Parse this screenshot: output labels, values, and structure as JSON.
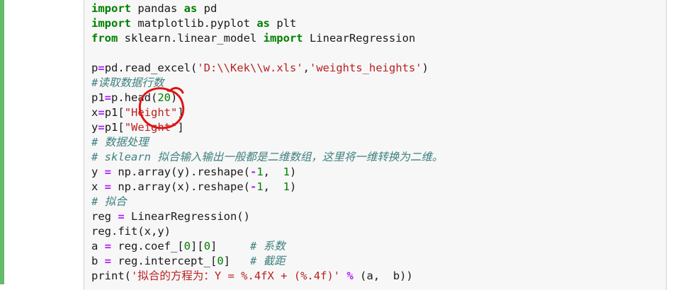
{
  "code_cell": {
    "lines": [
      [
        [
          "kw",
          "import"
        ],
        [
          "t",
          " pandas "
        ],
        [
          "kw",
          "as"
        ],
        [
          "t",
          " pd"
        ]
      ],
      [
        [
          "kw",
          "import"
        ],
        [
          "t",
          " matplotlib.pyplot "
        ],
        [
          "kw",
          "as"
        ],
        [
          "t",
          " plt"
        ]
      ],
      [
        [
          "kw",
          "from"
        ],
        [
          "t",
          " sklearn.linear_model "
        ],
        [
          "kw",
          "import"
        ],
        [
          "t",
          " LinearRegression"
        ]
      ],
      [],
      [
        [
          "t",
          "p"
        ],
        [
          "op",
          "="
        ],
        [
          "t",
          "pd.read_excel("
        ],
        [
          "str",
          "'D:\\\\Kek\\\\w.xls'"
        ],
        [
          "t",
          ","
        ],
        [
          "str",
          "'weights_heights'"
        ],
        [
          "t",
          ")"
        ]
      ],
      [
        [
          "cm",
          "#读取数据行数"
        ]
      ],
      [
        [
          "t",
          "p1"
        ],
        [
          "op",
          "="
        ],
        [
          "t",
          "p.head("
        ],
        [
          "num",
          "20"
        ],
        [
          "t",
          ")"
        ]
      ],
      [
        [
          "t",
          "x"
        ],
        [
          "op",
          "="
        ],
        [
          "t",
          "p1["
        ],
        [
          "str",
          "\"Height\""
        ],
        [
          "t",
          "]"
        ]
      ],
      [
        [
          "t",
          "y"
        ],
        [
          "op",
          "="
        ],
        [
          "t",
          "p1["
        ],
        [
          "str",
          "\"Weight\""
        ],
        [
          "t",
          "]"
        ]
      ],
      [
        [
          "cm",
          "# 数据处理"
        ]
      ],
      [
        [
          "cm",
          "# sklearn 拟合输入输出一般都是二维数组，这里将一维转换为二维。"
        ]
      ],
      [
        [
          "t",
          "y "
        ],
        [
          "op",
          "="
        ],
        [
          "t",
          " np.array(y).reshape("
        ],
        [
          "op",
          "-"
        ],
        [
          "num",
          "1"
        ],
        [
          "t",
          ",  "
        ],
        [
          "num",
          "1"
        ],
        [
          "t",
          ")"
        ]
      ],
      [
        [
          "t",
          "x "
        ],
        [
          "op",
          "="
        ],
        [
          "t",
          " np.array(x).reshape("
        ],
        [
          "op",
          "-"
        ],
        [
          "num",
          "1"
        ],
        [
          "t",
          ",  "
        ],
        [
          "num",
          "1"
        ],
        [
          "t",
          ")"
        ]
      ],
      [
        [
          "cm",
          "# 拟合"
        ]
      ],
      [
        [
          "t",
          "reg "
        ],
        [
          "op",
          "="
        ],
        [
          "t",
          " LinearRegression()"
        ]
      ],
      [
        [
          "t",
          "reg.fit(x,y)"
        ]
      ],
      [
        [
          "t",
          "a "
        ],
        [
          "op",
          "="
        ],
        [
          "t",
          " reg.coef_["
        ],
        [
          "num",
          "0"
        ],
        [
          "t",
          "]["
        ],
        [
          "num",
          "0"
        ],
        [
          "t",
          "]     "
        ],
        [
          "cm",
          "# 系数"
        ]
      ],
      [
        [
          "t",
          "b "
        ],
        [
          "op",
          "="
        ],
        [
          "t",
          " reg.intercept_["
        ],
        [
          "num",
          "0"
        ],
        [
          "t",
          "]   "
        ],
        [
          "cm",
          "# 截距"
        ]
      ],
      [
        [
          "t",
          "print("
        ],
        [
          "str",
          "'拟合的方程为：Y = %.4fX + (%.4f)'"
        ],
        [
          "t",
          " "
        ],
        [
          "op",
          "%"
        ],
        [
          "t",
          " (a,  b))"
        ]
      ]
    ]
  },
  "colors": {
    "keyword": "#008000",
    "operator": "#aa22ff",
    "string": "#ba2121",
    "number": "#008000",
    "comment": "#408080",
    "cell_background": "#f7f7f7",
    "active_bar": "#66bb6a",
    "annotation_ink": "#e01414"
  }
}
